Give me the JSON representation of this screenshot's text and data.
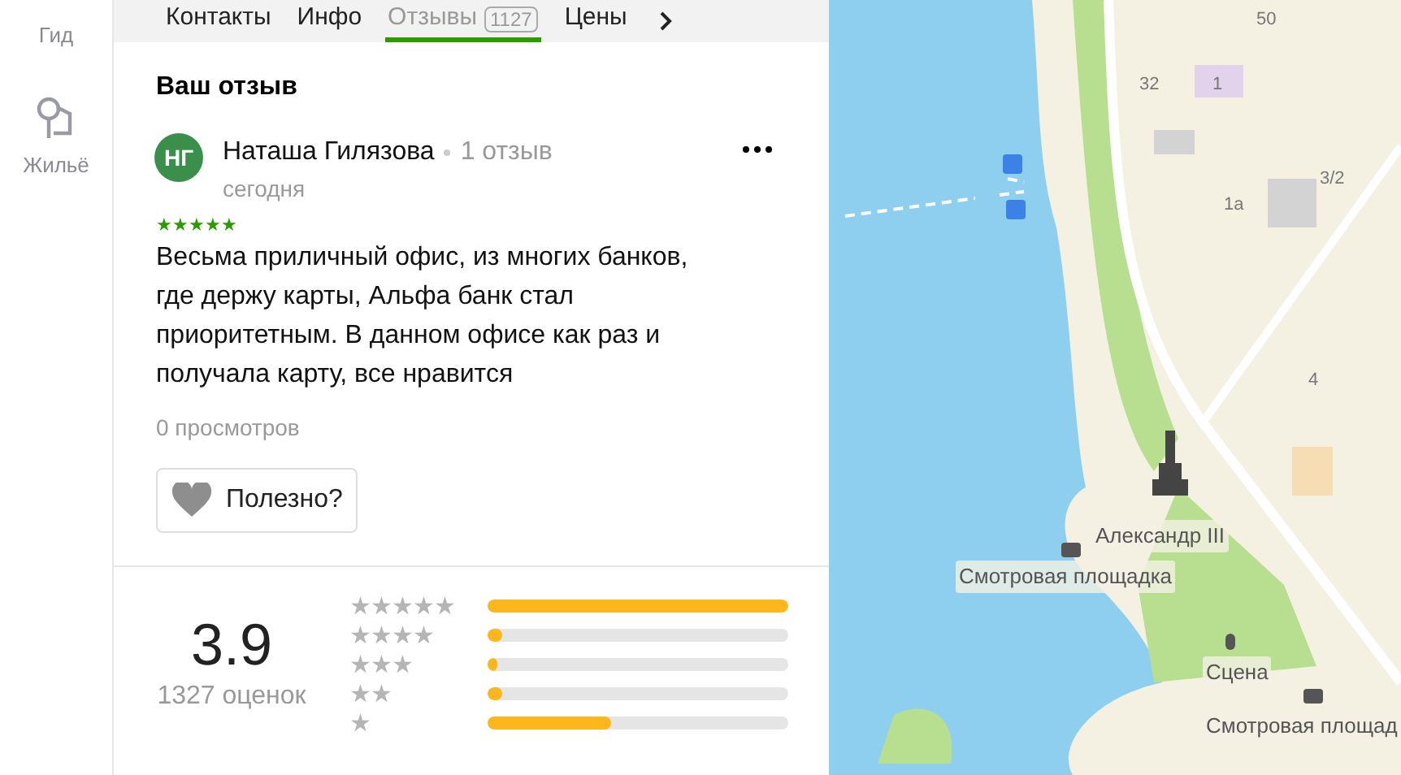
{
  "sidebar": {
    "items": [
      {
        "label": "Гид"
      },
      {
        "label": "Жильё"
      }
    ]
  },
  "tabs": [
    {
      "label": "Контакты",
      "selected": false
    },
    {
      "label": "Инфо",
      "selected": false
    },
    {
      "label": "Отзывы",
      "count": "1127",
      "selected": true
    },
    {
      "label": "Цены",
      "selected": false
    }
  ],
  "my_review": {
    "heading": "Ваш отзыв",
    "author": {
      "initials": "НГ",
      "name": "Наташа Гилязова",
      "reviews": "1 отзыв"
    },
    "date": "сегодня",
    "stars": 5,
    "text": "Весьма приличный офис, из многих банков, где держу карты, Альфа банк стал приоритетным. В данном офисе как раз и получала карту, все нравится",
    "views": "0 просмотров",
    "useful_button": "Полезно?"
  },
  "rating": {
    "score": "3.9",
    "count": "1327 оценок",
    "bars": [
      {
        "label": "★★★★★",
        "level": 1.0
      },
      {
        "label": "★★★★",
        "level": 0.05
      },
      {
        "label": "★★★",
        "level": 0.03
      },
      {
        "label": "★★",
        "level": 0.05
      },
      {
        "label": "★",
        "level": 0.41
      }
    ]
  },
  "map": {
    "labels": [
      {
        "kind": "house",
        "text": "50"
      },
      {
        "kind": "house",
        "text": "32"
      },
      {
        "kind": "house",
        "text": "1"
      },
      {
        "kind": "house",
        "text": "3/2"
      },
      {
        "kind": "house",
        "text": "1а"
      },
      {
        "kind": "house",
        "text": "4"
      },
      {
        "kind": "place",
        "text": "Александр III"
      },
      {
        "kind": "place",
        "text": "Смотровая площадка"
      },
      {
        "kind": "place",
        "text": "Сцена"
      },
      {
        "kind": "place",
        "text": "Смотровая площад"
      }
    ]
  }
}
